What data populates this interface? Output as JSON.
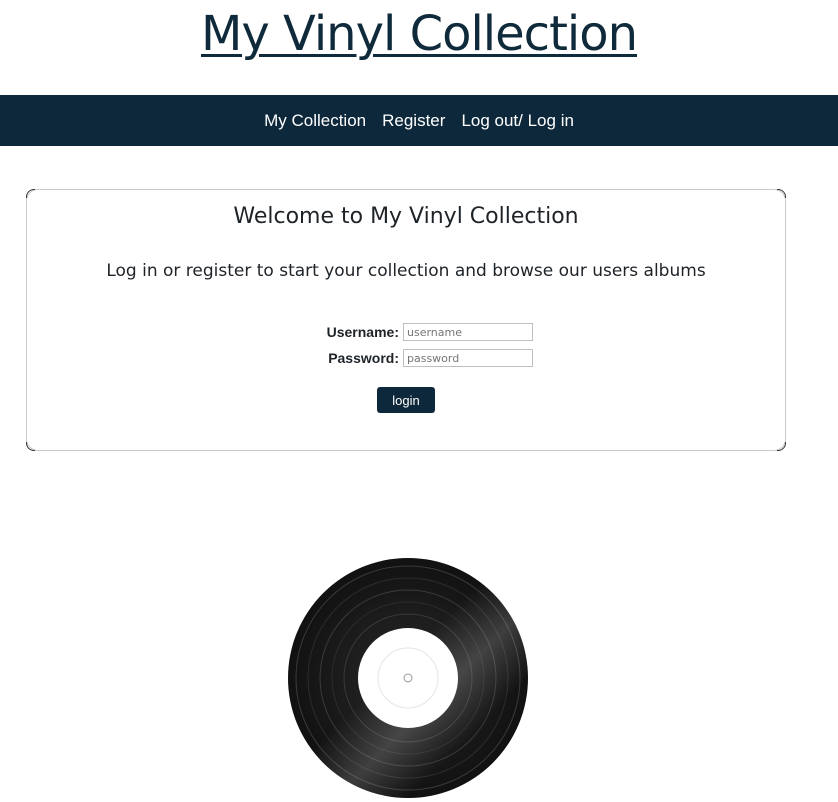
{
  "header": {
    "title": "My Vinyl Collection"
  },
  "nav": {
    "items": [
      {
        "label": "My Collection"
      },
      {
        "label": "Register"
      },
      {
        "label": "Log out/ Log in"
      }
    ]
  },
  "main": {
    "heading": "Welcome to My Vinyl Collection",
    "subheading": "Log in or register to start your collection and browse our users albums",
    "form": {
      "username_label": "Username:",
      "username_value": "",
      "username_placeholder": "username",
      "password_label": "Password:",
      "password_value": "",
      "password_placeholder": "password",
      "submit_label": "login"
    }
  },
  "image": {
    "name": "vinyl-record-image"
  },
  "colors": {
    "brand_dark": "#0d283a",
    "title_text": "#0f2a3b",
    "panel_border": "#c9c9c9"
  }
}
